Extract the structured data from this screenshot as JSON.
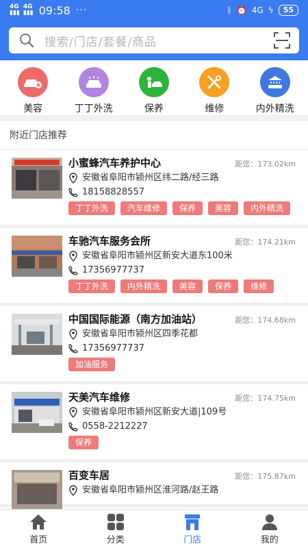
{
  "status_bar": {
    "net1": "4G",
    "net2": "4G",
    "time": "09:58",
    "dots": "···",
    "battery": "55",
    "net3": "4G"
  },
  "search": {
    "placeholder": "搜索/门店/套餐/商品"
  },
  "categories": [
    {
      "label": "美容",
      "color": "#ee6b6b",
      "icon": "car-plus-icon"
    },
    {
      "label": "丁丁外洗",
      "color": "#b184e0",
      "icon": "car-wash-icon"
    },
    {
      "label": "保养",
      "color": "#2eb33b",
      "icon": "maintenance-icon"
    },
    {
      "label": "维修",
      "color": "#f5a021",
      "icon": "wrench-icon"
    },
    {
      "label": "内外精洗",
      "color": "#3f78e0",
      "icon": "car-shower-icon"
    }
  ],
  "section_title": "附近门店推荐",
  "stores": [
    {
      "name": "小蜜蜂汽车养护中心",
      "distance": "距您：173.02km",
      "address": "安徽省阜阳市颍州区纬二路/经三路",
      "phone": "18158828557",
      "tags": [
        "丁丁外洗",
        "汽车维修",
        "保养",
        "美容",
        "内外精洗"
      ]
    },
    {
      "name": "车驰汽车服务会所",
      "distance": "距您：174.21km",
      "address": "安徽省阜阳市颍州区新安大道东100米",
      "phone": "17356977737",
      "tags": [
        "丁丁外洗",
        "内外精洗",
        "美容",
        "保养",
        "维修"
      ]
    },
    {
      "name": "中国国际能源（南方加油站）",
      "distance": "距您：174.68km",
      "address": "安徽省阜阳市颍州区四季花都",
      "phone": "17356977737",
      "tags": [
        "加油服务"
      ]
    },
    {
      "name": "天美汽车维修",
      "distance": "距您：174.75km",
      "address": "安徽省阜阳市颍州区新安大道|109号",
      "phone": "0558-2212227",
      "tags": [
        "保养"
      ]
    },
    {
      "name": "百变车居",
      "distance": "距您：175.87km",
      "address": "安徽省阜阳市颍州区淮河路/赵王路",
      "phone": "",
      "tags": []
    }
  ],
  "tabs": [
    {
      "label": "首页",
      "icon": "home-icon"
    },
    {
      "label": "分类",
      "icon": "grid-icon"
    },
    {
      "label": "门店",
      "icon": "store-icon",
      "active": true
    },
    {
      "label": "我的",
      "icon": "user-icon"
    }
  ],
  "colors": {
    "primary": "#3a7bf0",
    "tag": "#ee7b7a"
  }
}
